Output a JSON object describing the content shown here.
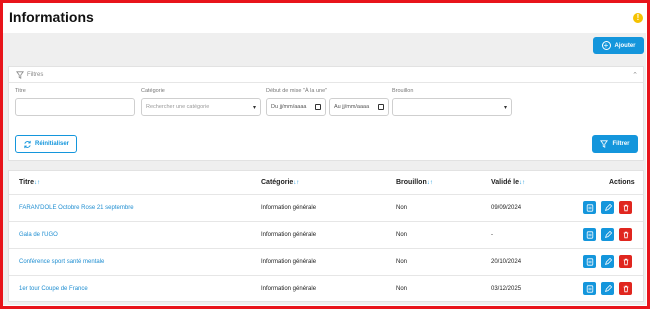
{
  "header": {
    "title": "Informations",
    "info_icon": "info-icon"
  },
  "toolbar": {
    "add_label": "Ajouter"
  },
  "filters": {
    "panel_label": "Filtres",
    "titre_label": "Titre",
    "titre_value": "",
    "categorie_label": "Catégorie",
    "categorie_placeholder": "Rechercher une catégorie",
    "debut_label": "Début de mise \"À la une\"",
    "du_prefix": "Du",
    "au_prefix": "Au",
    "date_placeholder": "jj/mm/aaaa",
    "brouillon_label": "Brouillon",
    "reset_label": "Réinitialiser",
    "filter_label": "Filtrer"
  },
  "table": {
    "columns": {
      "titre": "Titre",
      "categorie": "Catégorie",
      "brouillon": "Brouillon",
      "valide_le": "Validé le",
      "actions": "Actions"
    },
    "sort_glyph": "↓↑",
    "rows": [
      {
        "titre": "FARAN'DOLE Octobre Rose 21 septembre",
        "categorie": "Information générale",
        "brouillon": "Non",
        "valide_le": "09/09/2024"
      },
      {
        "titre": "Gala de l'UGO",
        "categorie": "Information générale",
        "brouillon": "Non",
        "valide_le": "-"
      },
      {
        "titre": "Conférence sport santé mentale",
        "categorie": "Information générale",
        "brouillon": "Non",
        "valide_le": "20/10/2024"
      },
      {
        "titre": "1er tour Coupe de France",
        "categorie": "Information générale",
        "brouillon": "Non",
        "valide_le": "03/12/2025"
      }
    ]
  },
  "colors": {
    "primary": "#1496dc",
    "danger": "#e0261f",
    "warning": "#f5c200",
    "frame": "#e8141b"
  }
}
